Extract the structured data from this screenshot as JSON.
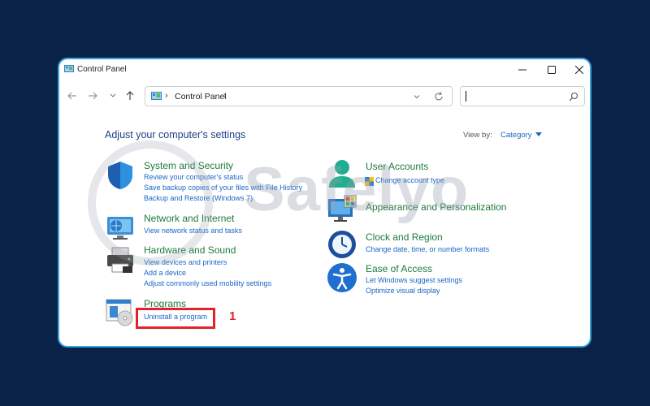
{
  "window": {
    "title": "Control Panel"
  },
  "address_bar": {
    "path": "Control Panel"
  },
  "search": {
    "placeholder": ""
  },
  "heading": "Adjust your computer's settings",
  "view_by": {
    "label": "View by:",
    "value": "Category"
  },
  "categories": [
    {
      "title": "System and Security",
      "icon": "shield-icon",
      "links": [
        "Review your computer's status",
        "Save backup copies of your files with File History",
        "Backup and Restore (Windows 7)"
      ]
    },
    {
      "title": "Network and Internet",
      "icon": "network-globe-icon",
      "links": [
        "View network status and tasks"
      ]
    },
    {
      "title": "Hardware and Sound",
      "icon": "printer-icon",
      "links": [
        "View devices and printers",
        "Add a device",
        "Adjust commonly used mobility settings"
      ]
    },
    {
      "title": "Programs",
      "icon": "programs-icon",
      "links": [
        "Uninstall a program"
      ]
    },
    {
      "title": "User Accounts",
      "icon": "user-accounts-icon",
      "links": [
        "Change account type"
      ]
    },
    {
      "title": "Appearance and Personalization",
      "icon": "monitor-palette-icon",
      "links": []
    },
    {
      "title": "Clock and Region",
      "icon": "clock-globe-icon",
      "links": [
        "Change date, time, or number formats"
      ]
    },
    {
      "title": "Ease of Access",
      "icon": "accessibility-icon",
      "links": [
        "Let Windows suggest settings",
        "Optimize visual display"
      ]
    }
  ],
  "annotation": {
    "step": "1"
  },
  "watermark": {
    "text": "Safelyo"
  },
  "colors": {
    "background": "#0a2248",
    "window_border": "#3b9fd9",
    "category_title": "#1e7a3c",
    "link": "#1a67c8",
    "heading": "#1e3f87",
    "highlight": "#e0242b"
  }
}
